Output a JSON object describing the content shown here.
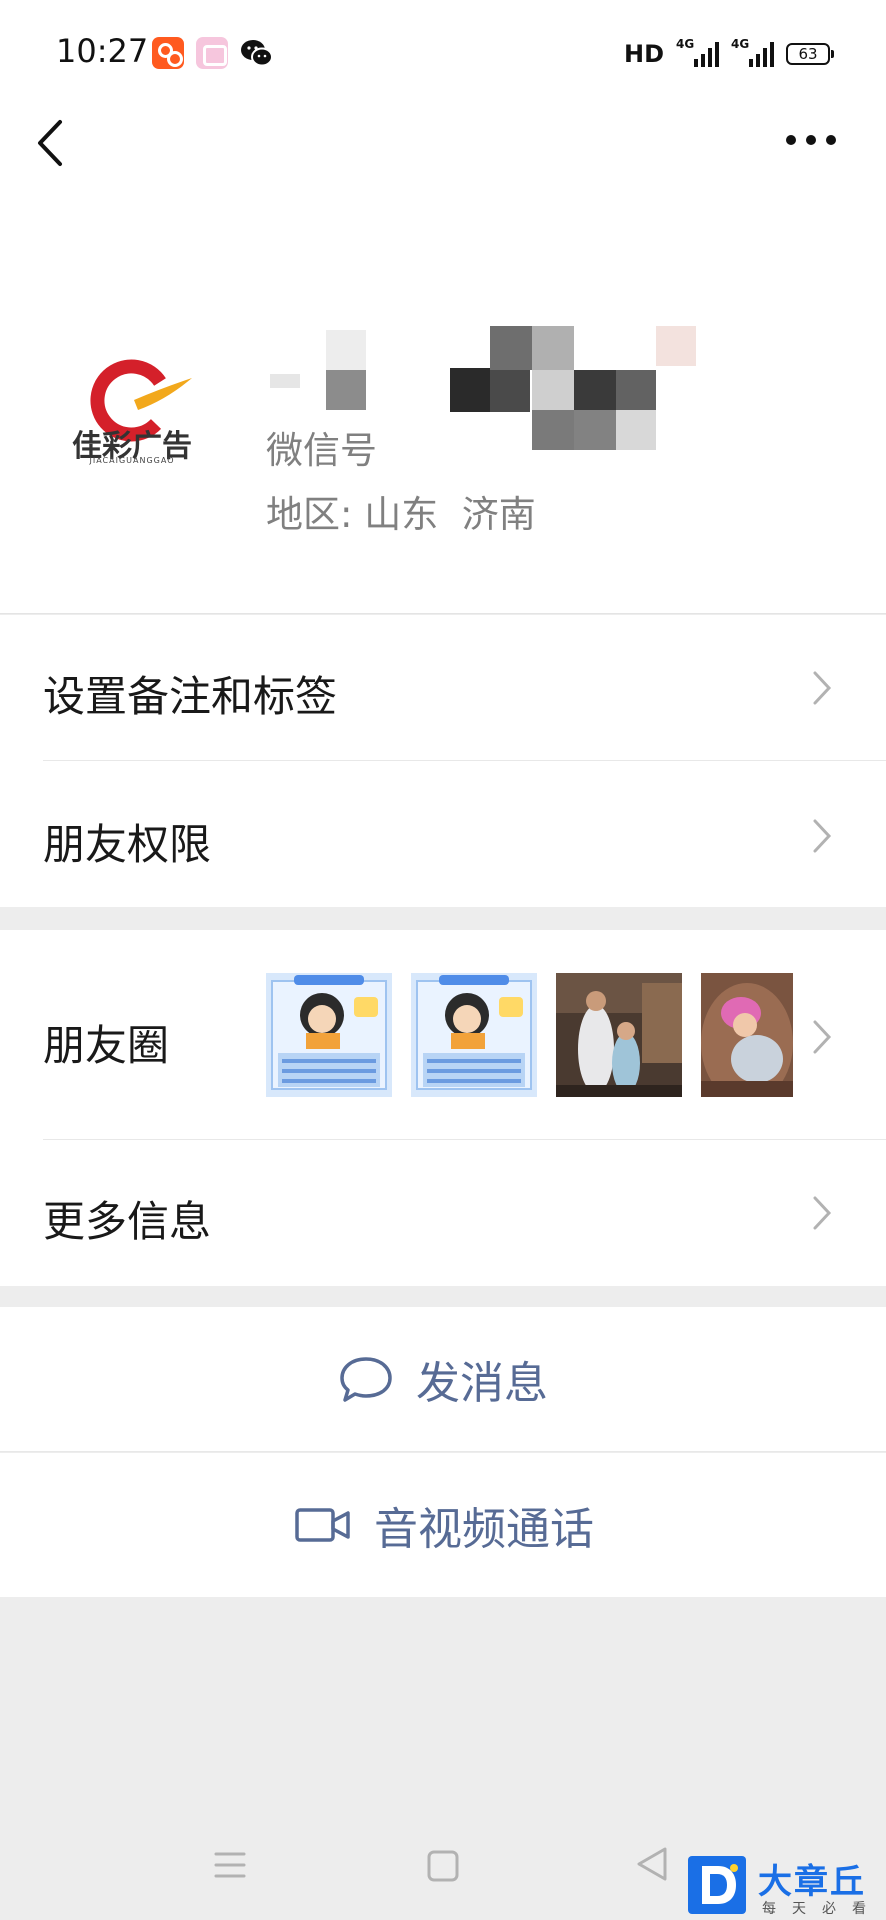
{
  "status_bar": {
    "time": "10:27",
    "network": "HD",
    "signal_1_tag": "4G",
    "signal_2_tag": "4G",
    "battery": "63",
    "notification_icons": [
      "kuaishou-icon",
      "photo-app-icon",
      "wechat-icon"
    ]
  },
  "nav": {
    "back_icon": "chevron-left-icon",
    "more_icon": "ellipsis-icon"
  },
  "profile": {
    "avatar_text": "佳彩广告",
    "avatar_caption": "JIACAIGUANGGAO",
    "wechat_id_label": "微信号",
    "region_label": "地区:",
    "region_value": "山东  济南"
  },
  "menu": {
    "remark_tags": "设置备注和标签",
    "friend_permission": "朋友权限",
    "moments": "朋友圈",
    "more_info": "更多信息"
  },
  "actions": {
    "send_message": "发消息",
    "video_call": "音视频通话"
  },
  "watermark": {
    "title": "大章丘",
    "subtitle": "每天必看"
  },
  "colors": {
    "link_blue": "#576b95",
    "page_bg": "#ededed",
    "logo_red": "#d4202a",
    "logo_gold": "#f2a81c"
  }
}
